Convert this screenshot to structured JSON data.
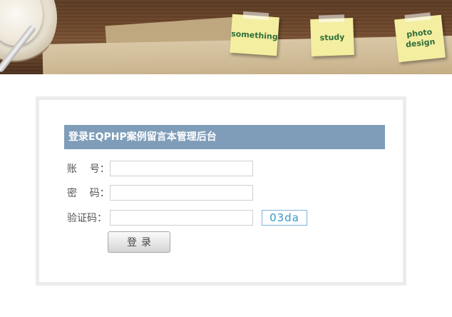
{
  "header": {
    "notes": [
      "something",
      "study",
      "photo\ndesign"
    ]
  },
  "login": {
    "title": "登录EQPHP案例留言本管理后台",
    "account_label": "账    号：",
    "password_label": "密    码：",
    "captcha_label": "验证码：",
    "account_value": "",
    "password_value": "",
    "captcha_value": "",
    "captcha_image_text": "03da",
    "submit_label": "登录"
  },
  "colors": {
    "title_bar": "#7f9db9",
    "captcha_text": "#3399cc",
    "note": "#f4eea0",
    "note_text": "#2f6e3a"
  }
}
